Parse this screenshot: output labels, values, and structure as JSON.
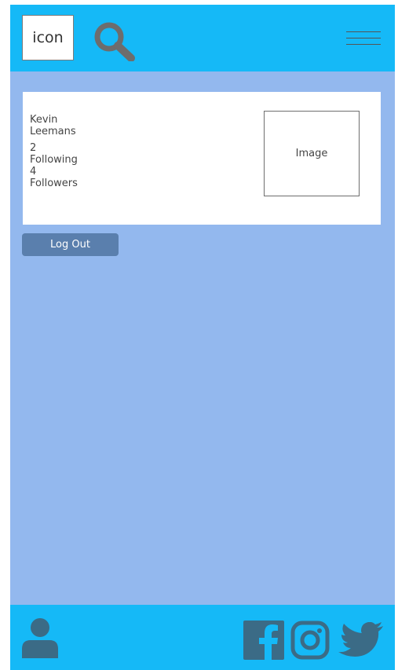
{
  "header": {
    "logo_text": "icon",
    "search_icon": "search-icon",
    "menu_icon": "hamburger-menu-icon"
  },
  "profile": {
    "first_name": "Kevin",
    "last_name": "Leemans",
    "following_count": "2",
    "following_label": "Following",
    "followers_count": "4",
    "followers_label": "Followers",
    "image_label": "Image"
  },
  "actions": {
    "logout_label": "Log Out"
  },
  "footer": {
    "icons": [
      "user-icon",
      "facebook-icon",
      "instagram-icon",
      "twitter-icon"
    ]
  },
  "colors": {
    "header_bg": "#15b9f7",
    "page_bg": "#93b8ee",
    "card_bg": "#ffffff",
    "button_bg": "#5a7fad",
    "icon_gray": "#6d6d6d",
    "footer_icon": "#3b6b86"
  }
}
